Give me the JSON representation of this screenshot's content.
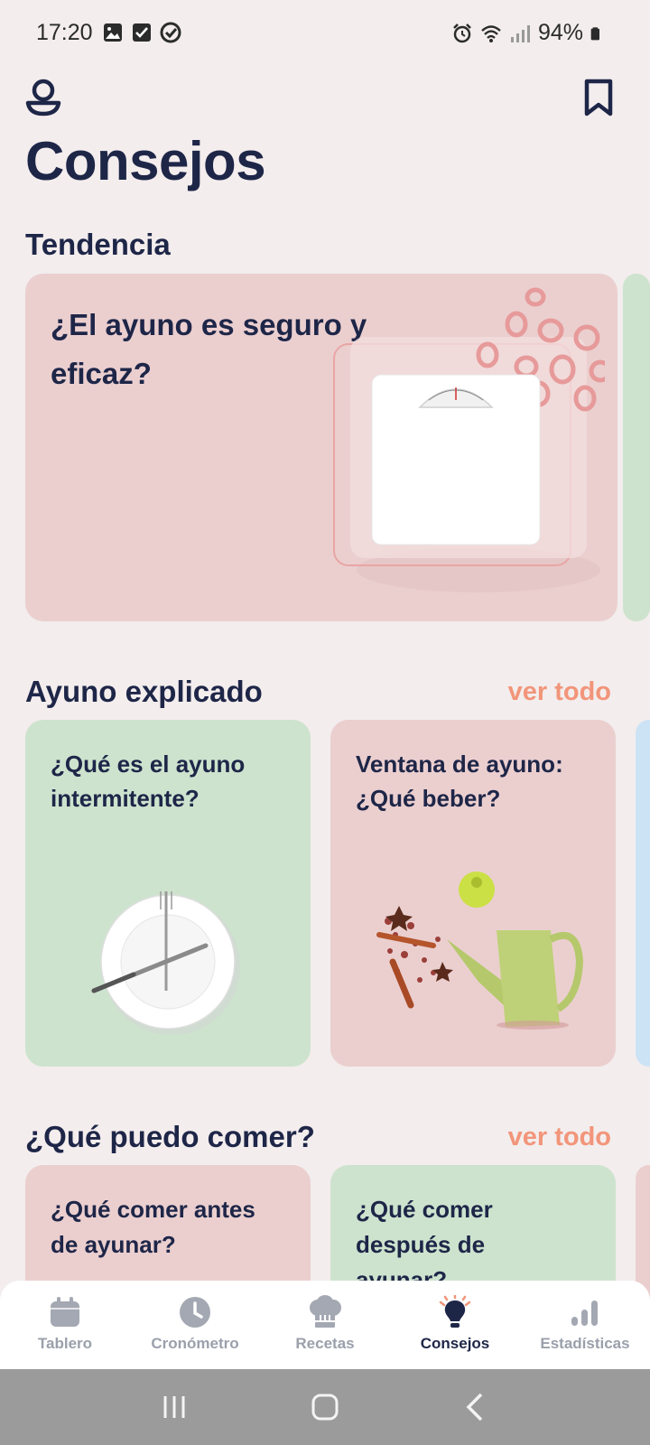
{
  "status_bar": {
    "time": "17:20",
    "battery": "94%",
    "left_icons": [
      "image-icon",
      "checkbox-icon",
      "check-circle-icon"
    ],
    "right_icons": [
      "alarm-icon",
      "wifi-icon",
      "signal-icon",
      "battery-icon"
    ]
  },
  "header": {
    "title": "Consejos",
    "profile_icon": "profile-icon",
    "bookmark_icon": "bookmark-icon"
  },
  "trending": {
    "section_title": "Tendencia",
    "card": {
      "title": "¿El ayuno es seguro y eficaz?",
      "image": "bathroom-scale"
    }
  },
  "fasting_explained": {
    "section_title": "Ayuno explicado",
    "see_all": "ver todo",
    "cards": [
      {
        "title": "¿Qué es el ayuno intermitente?",
        "image": "empty-plate-fork-knife",
        "color": "#CDE3CE"
      },
      {
        "title": "Ventana de ayuno: ¿Qué beber?",
        "image": "teapot-and-spices",
        "color": "#EBCFCF"
      }
    ]
  },
  "what_can_i_eat": {
    "section_title": "¿Qué puedo comer?",
    "see_all": "ver todo",
    "cards": [
      {
        "title": "¿Qué comer antes de ayunar?",
        "color": "#EBCFCF"
      },
      {
        "title": "¿Qué comer después de ayunar?",
        "color": "#CDE3CE"
      }
    ]
  },
  "bottom_nav": {
    "items": [
      {
        "label": "Tablero",
        "icon": "calendar-icon",
        "active": false
      },
      {
        "label": "Cronómetro",
        "icon": "clock-icon",
        "active": false
      },
      {
        "label": "Recetas",
        "icon": "chef-hat-icon",
        "active": false
      },
      {
        "label": "Consejos",
        "icon": "lightbulb-icon",
        "active": true
      },
      {
        "label": "Estadísticas",
        "icon": "bar-chart-icon",
        "active": false
      }
    ]
  },
  "colors": {
    "background": "#F3EDED",
    "title": "#1E2648",
    "accent": "#F2957A",
    "card_pink": "#EBCFCF",
    "card_green": "#CDE3CE",
    "card_blue": "#CCE3F5",
    "nav_inactive": "#9AA0AB"
  }
}
